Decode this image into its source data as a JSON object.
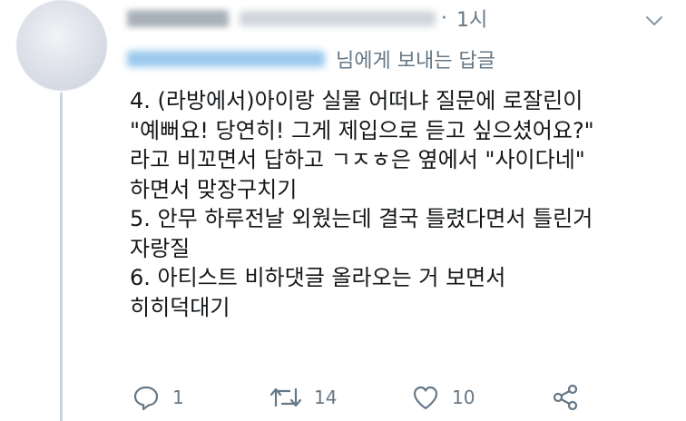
{
  "header": {
    "dot": "·",
    "time": "1시"
  },
  "reply_context": {
    "suffix": "님에게 보내는 답글"
  },
  "tweet": {
    "lines": [
      "4. (라방에서)아이랑 실물 어떠냐 질문에 로잘린이",
      "\"예뻐요! 당연히! 그게 제입으로 듣고 싶으셨어요?\"",
      "라고 비꼬면서 답하고 ㄱㅈㅎ은 옆에서 \"사이다네\"",
      "하면서 맞장구치기",
      "5. 안무 하루전날 외웠는데 결국 틀렸다면서 틀린거",
      "자랑질",
      "6. 아티스트 비하댓글 올라오는 거 보면서",
      "히히덕대기"
    ]
  },
  "actions": {
    "reply_count": "1",
    "retweet_count": "14",
    "like_count": "10"
  },
  "colors": {
    "text": "#14171a",
    "secondary": "#657786",
    "thread_line": "#ccd6dd"
  },
  "icons": [
    "chevron-down-icon",
    "reply-icon",
    "retweet-icon",
    "heart-icon",
    "share-icon"
  ]
}
